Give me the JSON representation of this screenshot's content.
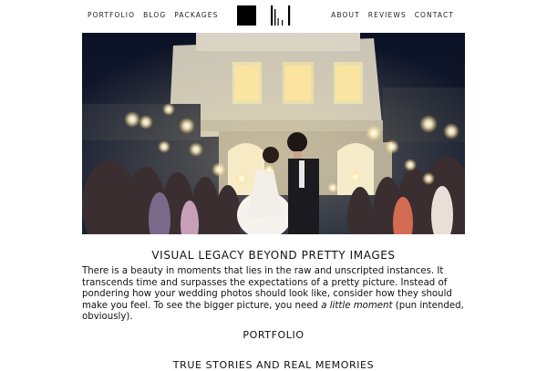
{
  "nav": {
    "left": [
      "PORTFOLIO",
      "BLOG",
      "PACKAGES"
    ],
    "right": [
      "ABOUT",
      "REVIEWS",
      "CONTACT"
    ]
  },
  "hero": {
    "description_icon": "wedding-sparkler-photo"
  },
  "intro": {
    "title": "VISUAL LEGACY BEYOND PRETTY IMAGES",
    "body_before": "There is a beauty in moments that lies in the raw and unscripted instances. It transcends time and surpasses the expectations of a pretty picture. Instead of pondering how your wedding photos should look like, consider how they should make you feel. To see the bigger picture, you need ",
    "body_em": "a little moment",
    "body_after": " (pun intended, obviously)."
  },
  "sections": {
    "portfolio_heading": "PORTFOLIO",
    "next_heading": "TRUE STORIES AND REAL MEMORIES"
  },
  "colors": {
    "accent": "#111111",
    "background": "#ffffff"
  }
}
